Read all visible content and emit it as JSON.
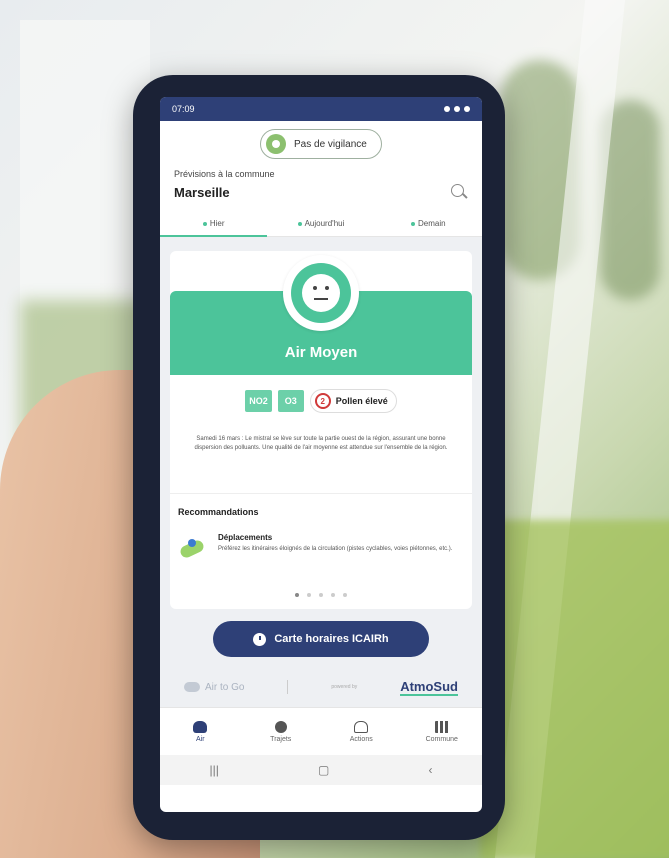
{
  "status": {
    "time": "07:09"
  },
  "vigilance": {
    "label": "Pas de vigilance"
  },
  "forecast": {
    "label": "Prévisions à la commune",
    "city": "Marseille"
  },
  "tabs": [
    "Hier",
    "Aujourd'hui",
    "Demain"
  ],
  "air": {
    "title": "Air Moyen",
    "pollutants": [
      "NO2",
      "O3"
    ],
    "pollen": {
      "number": "2",
      "label": "Pollen élevé"
    },
    "description": "Samedi 16 mars : Le mistral se lève sur toute la partie ouest de la région, assurant une bonne dispersion des polluants. Une qualité de l'air moyenne est attendue sur l'ensemble de la région."
  },
  "recommendations": {
    "title": "Recommandations",
    "item": {
      "title": "Déplacements",
      "body": "Préférez les itinéraires éloignés de la circulation (pistes cyclables, voies piétonnes, etc.)."
    },
    "pages": 5,
    "current_page": 1
  },
  "cta": {
    "label": "Carte horaires ICAIRh"
  },
  "partners": {
    "airtogo": "Air to Go",
    "powered": "powered by",
    "atmosud": "AtmoSud"
  },
  "nav": [
    {
      "label": "Air",
      "icon": "cloud-icon"
    },
    {
      "label": "Trajets",
      "icon": "route-icon"
    },
    {
      "label": "Actions",
      "icon": "bell-icon"
    },
    {
      "label": "Commune",
      "icon": "city-icon"
    }
  ],
  "sysnav": {
    "recent": "|||",
    "home": "▢",
    "back": "‹"
  },
  "colors": {
    "primary": "#2e4077",
    "accent": "#4cc49a"
  }
}
